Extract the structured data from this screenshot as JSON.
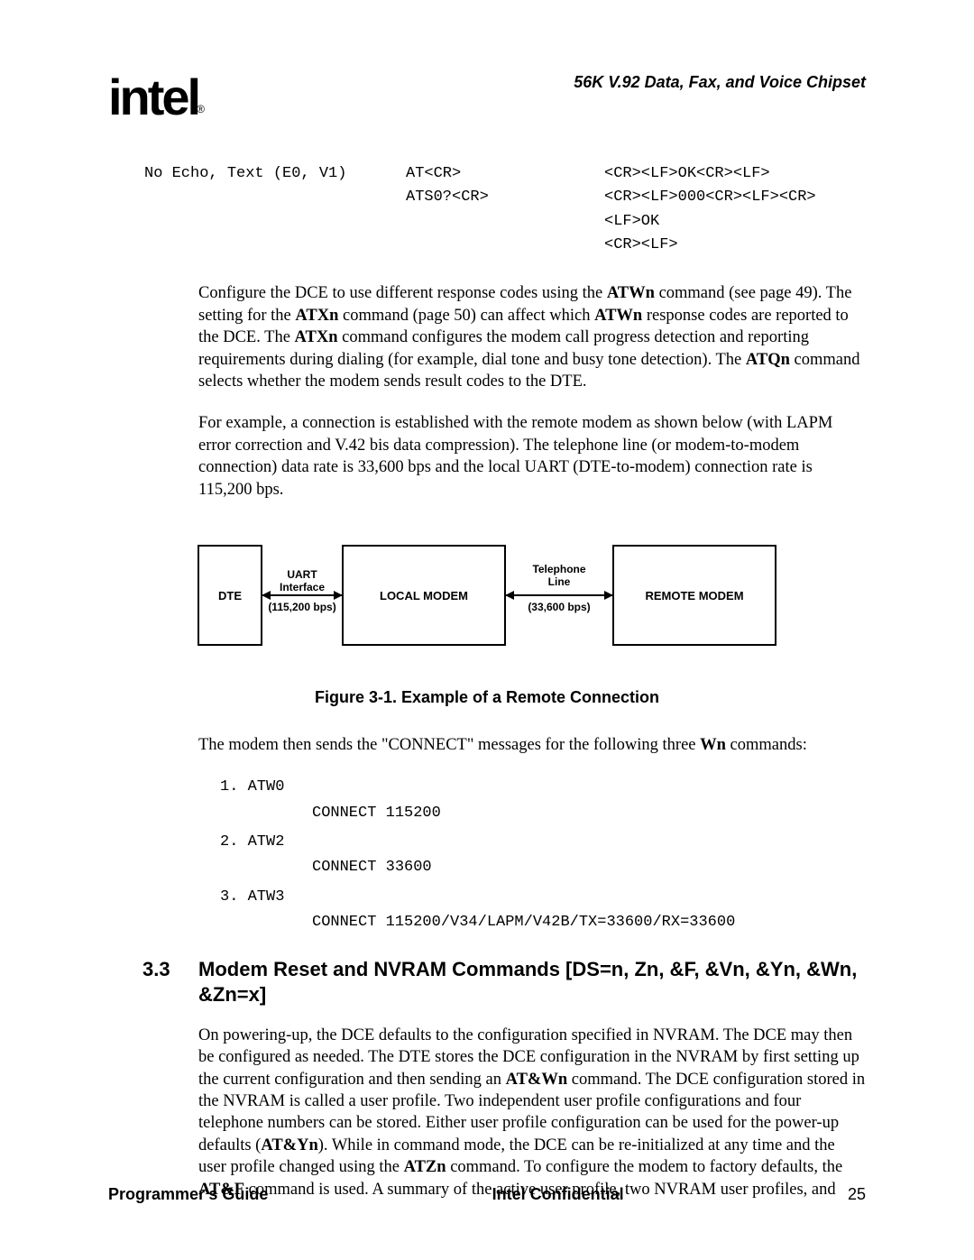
{
  "header": {
    "logo_text": "intel",
    "logo_reg": "®",
    "doc_title": "56K V.92 Data, Fax, and Voice Chipset"
  },
  "code_table": {
    "row1": {
      "c1": "No Echo, Text (E0, V1)",
      "c2": "AT<CR>",
      "c3": "<CR><LF>OK<CR><LF>"
    },
    "row2": {
      "c1": "",
      "c2": "ATS0?<CR>",
      "c3": "<CR><LF>000<CR><LF><CR><LF>OK"
    },
    "row3": {
      "c1": "",
      "c2": "",
      "c3": "<CR><LF>"
    }
  },
  "para1": {
    "t1": "Configure the DCE to use different response codes using the ",
    "b1": "ATWn",
    "t2": " command (see page 49). The setting for the ",
    "b2": "ATXn",
    "t3": " command (page 50) can affect which ",
    "b3": "ATWn",
    "t4": " response codes are reported to the DCE. The ",
    "b4": "ATXn",
    "t5": " command configures the modem call progress detection and reporting requirements during dialing (for example, dial tone and busy tone detection). The ",
    "b5": "ATQn",
    "t6": " command selects whether the modem sends result codes to the DTE."
  },
  "para2": "For example, a connection is established with the remote modem as shown below (with LAPM error correction and V.42 bis data compression). The telephone line (or modem-to-modem connection) data rate is 33,600 bps and the local UART (DTE-to-modem) connection rate is 115,200 bps.",
  "diagram": {
    "dte": "DTE",
    "uart1": "UART",
    "uart2": "Interface",
    "uart3": "(115,200 bps)",
    "local": "LOCAL MODEM",
    "tel1": "Telephone",
    "tel2": "Line",
    "tel3": "(33,600 bps)",
    "remote": "REMOTE MODEM"
  },
  "figure_caption": "Figure 3-1.  Example of a Remote Connection",
  "para3": {
    "t1": "The modem then sends the \"CONNECT\" messages for the following three ",
    "b1": "Wn",
    "t2": " commands:"
  },
  "connect_list": {
    "i1": "1. ATW0",
    "r1": "CONNECT 115200",
    "i2": "2. ATW2",
    "r2": "CONNECT 33600",
    "i3": "3. ATW3",
    "r3": "CONNECT 115200/V34/LAPM/V42B/TX=33600/RX=33600"
  },
  "section": {
    "num": "3.3",
    "title": "Modem Reset and NVRAM Commands [DS=n, Zn, &F, &Vn, &Yn, &Wn, &Zn=x]"
  },
  "para4": {
    "t1": "On powering-up, the DCE defaults to the configuration specified in NVRAM. The DCE may then be configured as needed. The DTE stores the DCE configuration in the NVRAM by first setting up the current configuration and then sending an ",
    "b1": "AT&Wn",
    "t2": " command. The DCE configuration stored in the NVRAM is called a user profile. Two independent user profile configurations and four telephone numbers can be stored. Either user profile configuration can be used for the power-up defaults (",
    "b2": "AT&Yn",
    "t3": "). While in command mode, the DCE can be re-initialized at any time and the user profile changed using the ",
    "b3": "ATZn",
    "t4": " command. To configure the modem to factory defaults, the ",
    "b4": "AT&F",
    "t5": " command is used. A summary of the active user profile, two NVRAM user profiles, and"
  },
  "footer": {
    "left": "Programmer's Guide",
    "center": "Intel Confidential",
    "right": "25"
  },
  "chart_data": {
    "type": "diagram",
    "nodes": [
      {
        "id": "dte",
        "label": "DTE"
      },
      {
        "id": "local_modem",
        "label": "LOCAL MODEM"
      },
      {
        "id": "remote_modem",
        "label": "REMOTE MODEM"
      }
    ],
    "edges": [
      {
        "from": "dte",
        "to": "local_modem",
        "label": "UART Interface (115,200 bps)",
        "bidirectional": true
      },
      {
        "from": "local_modem",
        "to": "remote_modem",
        "label": "Telephone Line (33,600 bps)",
        "bidirectional": true
      }
    ],
    "title": "Figure 3-1. Example of a Remote Connection"
  }
}
